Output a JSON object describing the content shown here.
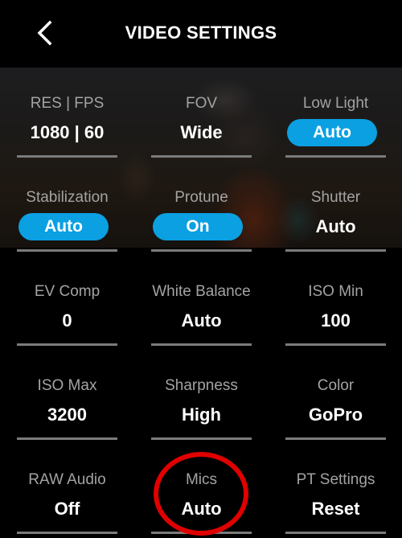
{
  "header": {
    "title": "VIDEO SETTINGS",
    "back_icon": "chevron-left-icon"
  },
  "colors": {
    "pill_active": "#0aa0e2",
    "label": "#a3a3a3",
    "underline": "#7b7b7b",
    "annotation": "#e00000"
  },
  "settings": [
    {
      "label": "RES | FPS",
      "value": "1080 | 60",
      "pill": false
    },
    {
      "label": "FOV",
      "value": "Wide",
      "pill": false
    },
    {
      "label": "Low Light",
      "value": "Auto",
      "pill": true
    },
    {
      "label": "Stabilization",
      "value": "Auto",
      "pill": true
    },
    {
      "label": "Protune",
      "value": "On",
      "pill": true
    },
    {
      "label": "Shutter",
      "value": "Auto",
      "pill": false
    },
    {
      "label": "EV Comp",
      "value": "0",
      "pill": false
    },
    {
      "label": "White Balance",
      "value": "Auto",
      "pill": false
    },
    {
      "label": "ISO Min",
      "value": "100",
      "pill": false
    },
    {
      "label": "ISO Max",
      "value": "3200",
      "pill": false
    },
    {
      "label": "Sharpness",
      "value": "High",
      "pill": false
    },
    {
      "label": "Color",
      "value": "GoPro",
      "pill": false
    },
    {
      "label": "RAW Audio",
      "value": "Off",
      "pill": false
    },
    {
      "label": "Mics",
      "value": "Auto",
      "pill": false
    },
    {
      "label": "PT Settings",
      "value": "Reset",
      "pill": false
    }
  ],
  "annotation": {
    "target": "Mics",
    "shape": "circle"
  }
}
